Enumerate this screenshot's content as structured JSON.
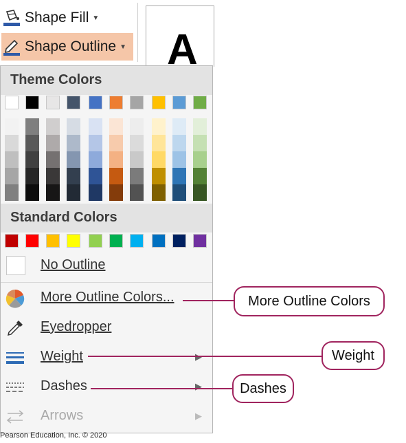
{
  "ribbon": {
    "shape_fill_label": "Shape Fill",
    "shape_outline_label": "Shape Outline",
    "preview_letter": "A"
  },
  "menu": {
    "theme_colors_label": "Theme Colors",
    "standard_colors_label": "Standard Colors",
    "theme_top": [
      "#ffffff",
      "#000000",
      "#e7e6e6",
      "#44546a",
      "#4472c4",
      "#ed7d31",
      "#a5a5a5",
      "#ffc000",
      "#5b9bd5",
      "#70ad47"
    ],
    "theme_shades": [
      [
        "#f2f2f2",
        "#d9d9d9",
        "#bfbfbf",
        "#a6a6a6",
        "#808080"
      ],
      [
        "#7f7f7f",
        "#595959",
        "#404040",
        "#262626",
        "#0d0d0d"
      ],
      [
        "#d0cece",
        "#aeaaaa",
        "#757171",
        "#3a3838",
        "#171616"
      ],
      [
        "#d6dce4",
        "#adb9ca",
        "#8496b0",
        "#333f4f",
        "#222a35"
      ],
      [
        "#d9e2f3",
        "#b4c6e7",
        "#8eaadb",
        "#2f5496",
        "#1f3864"
      ],
      [
        "#fbe5d5",
        "#f7cbac",
        "#f4b183",
        "#c55a11",
        "#843c0b"
      ],
      [
        "#ededed",
        "#dbdbdb",
        "#c9c9c9",
        "#7b7b7b",
        "#525252"
      ],
      [
        "#fff2cc",
        "#ffe599",
        "#ffd966",
        "#bf8f00",
        "#7f6000"
      ],
      [
        "#deebf6",
        "#bdd7ee",
        "#9dc3e6",
        "#2e75b5",
        "#1f4e79"
      ],
      [
        "#e2efd9",
        "#c5e0b3",
        "#a8d08d",
        "#538135",
        "#375623"
      ]
    ],
    "standard": [
      "#c00000",
      "#ff0000",
      "#ffc000",
      "#ffff00",
      "#92d050",
      "#00b050",
      "#00b0f0",
      "#0070c0",
      "#002060",
      "#7030a0"
    ],
    "no_outline_label": "No Outline",
    "more_outline_colors_label": "More Outline Colors...",
    "eyedropper_label": "Eyedropper",
    "weight_label": "Weight",
    "dashes_label": "Dashes",
    "arrows_label": "Arrows"
  },
  "callouts": {
    "more_outline_colors": "More Outline Colors",
    "weight": "Weight",
    "dashes": "Dashes"
  },
  "credit": "Pearson Education, Inc. © 2020",
  "colors": {
    "accent": "#a0245e",
    "active_button": "#f5c6a8"
  }
}
